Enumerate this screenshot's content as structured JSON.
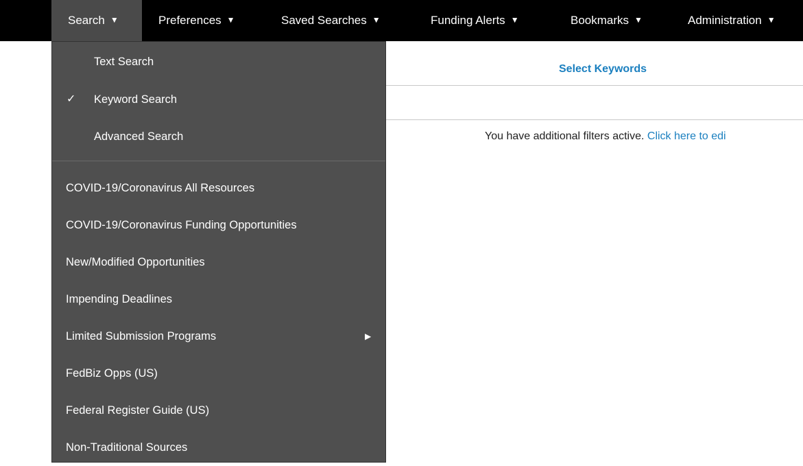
{
  "nav": {
    "items": [
      {
        "label": "Search",
        "caret": "▼"
      },
      {
        "label": "Preferences",
        "caret": "▼"
      },
      {
        "label": "Saved Searches",
        "caret": "▼"
      },
      {
        "label": "Funding Alerts",
        "caret": "▼"
      },
      {
        "label": "Bookmarks",
        "caret": "▼"
      },
      {
        "label": "Administration",
        "caret": "▼"
      }
    ]
  },
  "search_menu": {
    "search_modes": [
      {
        "label": "Text Search",
        "checked": false
      },
      {
        "label": "Keyword Search",
        "checked": true,
        "check_glyph": "✓"
      },
      {
        "label": "Advanced Search",
        "checked": false
      }
    ],
    "resources": [
      {
        "label": "COVID-19/Coronavirus All Resources"
      },
      {
        "label": "COVID-19/Coronavirus Funding Opportunities"
      },
      {
        "label": "New/Modified Opportunities"
      },
      {
        "label": "Impending Deadlines"
      },
      {
        "label": "Limited Submission Programs",
        "submenu_arrow": "▶"
      },
      {
        "label": "FedBiz Opps (US)"
      },
      {
        "label": "Federal Register Guide (US)"
      },
      {
        "label": "Non-Traditional Sources"
      }
    ]
  },
  "content": {
    "select_keywords": "Select Keywords",
    "filters_text": "You have additional filters active. ",
    "filters_link": "Click here to edi"
  },
  "colors": {
    "nav_bg": "#000000",
    "menu_bg": "#4f4f4f",
    "active_nav_bg": "#4a4a4a",
    "link": "#1a7fbf"
  }
}
